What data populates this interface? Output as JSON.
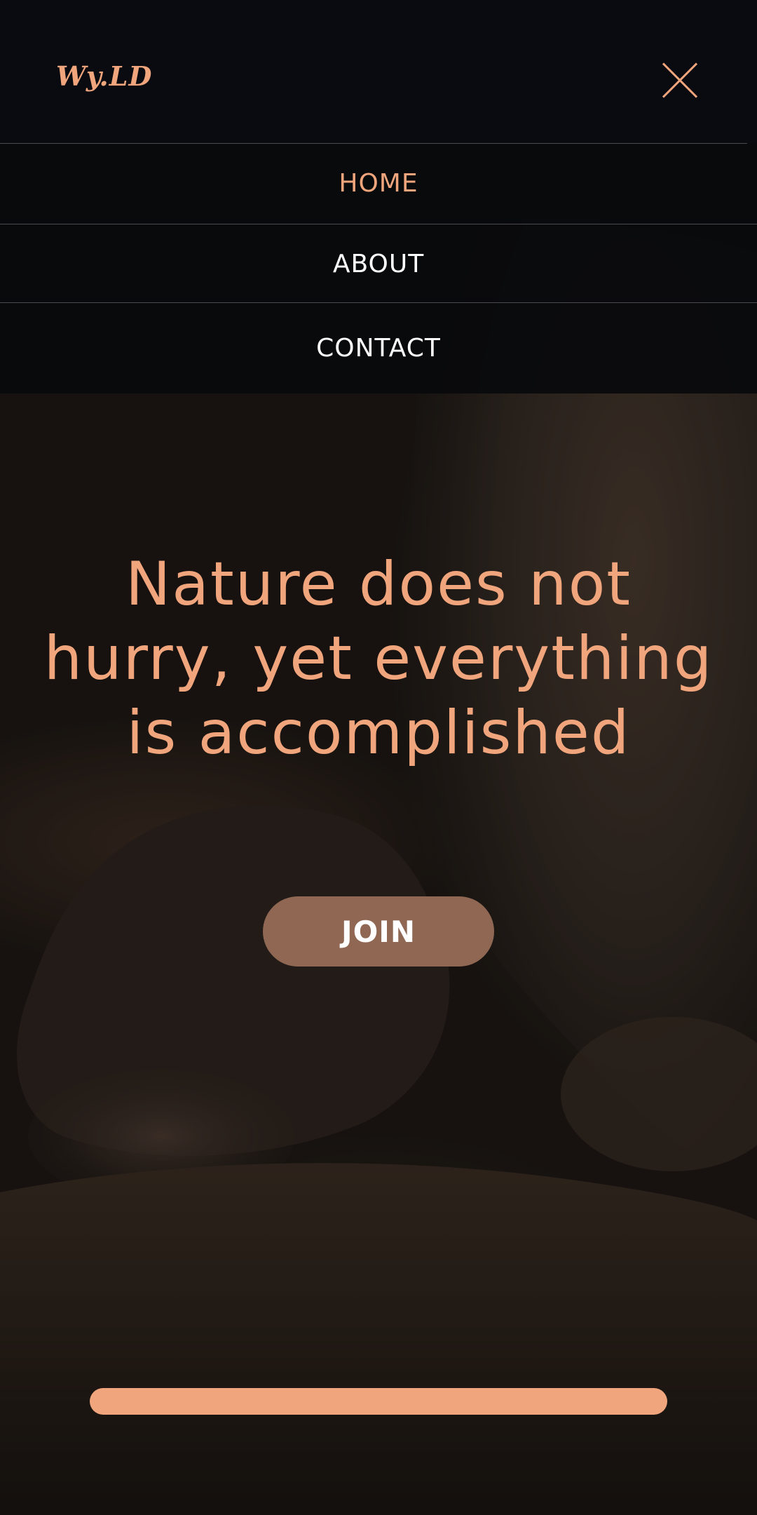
{
  "header": {
    "logo_text": "Wy.LD",
    "close_icon": "close-icon"
  },
  "nav": {
    "items": [
      {
        "label": "HOME",
        "active": true
      },
      {
        "label": "ABOUT",
        "active": false
      },
      {
        "label": "CONTACT",
        "active": false
      }
    ]
  },
  "hero": {
    "title": "Nature does not hurry, yet everything is accomplished",
    "join_label": "JOIN",
    "background": "lion-photo"
  },
  "colors": {
    "accent": "#f0a57c",
    "button": "#8f6753",
    "header_bg": "#0a0b10"
  }
}
